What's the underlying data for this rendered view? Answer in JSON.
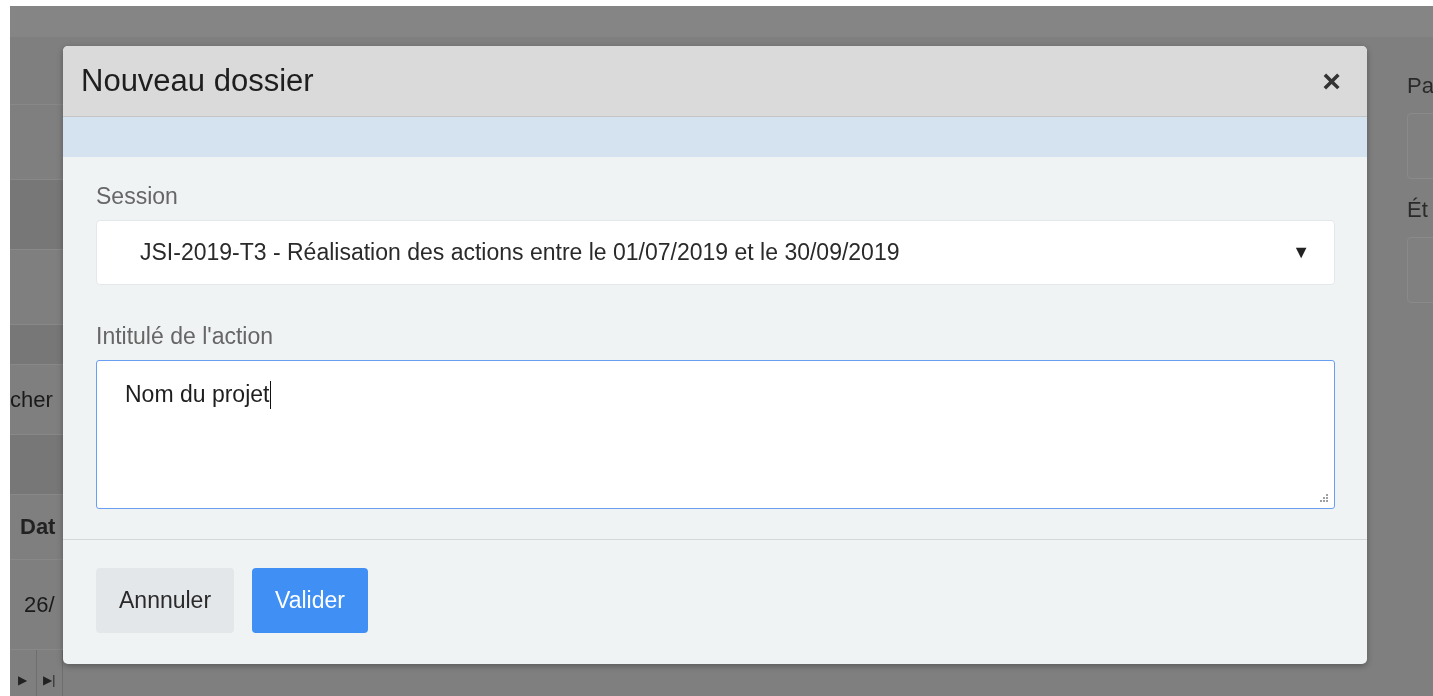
{
  "backdrop": {
    "left_texts": [
      "cher",
      "Dat",
      "26/"
    ],
    "pager": [
      "▶",
      "▶|"
    ],
    "right_labels": [
      "Pa",
      "Ét"
    ]
  },
  "dialog": {
    "title": "Nouveau dossier",
    "close": "×",
    "fields": [
      {
        "kind": "select",
        "label": "Session",
        "value": "JSI-2019-T3 - Réalisation des actions entre le 01/07/2019 et le 30/09/2019",
        "caret": "▼",
        "focused": false
      },
      {
        "kind": "textarea",
        "label": "Intitulé de l'action",
        "value": "Nom du projet",
        "focused": true
      }
    ],
    "buttons": [
      {
        "label": "Annnuler",
        "kind": "secondary"
      },
      {
        "label": "Valider",
        "kind": "primary"
      }
    ]
  }
}
